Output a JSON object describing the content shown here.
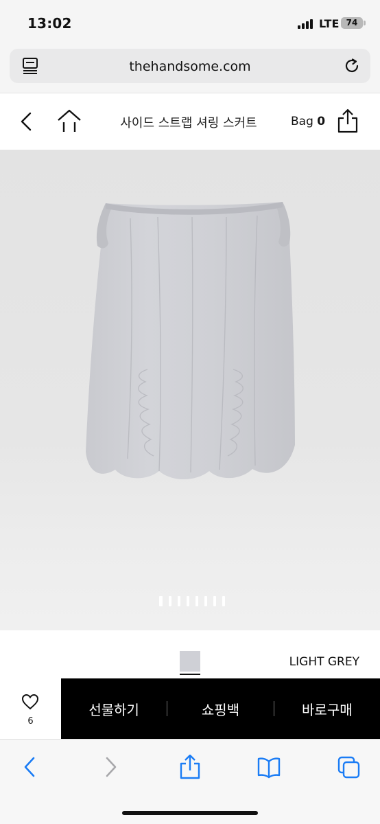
{
  "status_bar": {
    "time": "13:02",
    "carrier": "LTE",
    "battery": "74"
  },
  "browser": {
    "url": "thehandsome.com"
  },
  "header": {
    "title": "사이드 스트랩 셔링 스커트",
    "bag_label": "Bag",
    "bag_count": "0"
  },
  "gallery": {
    "image_count": 8,
    "active_index": 0
  },
  "product": {
    "color_name": "LIGHT GREY",
    "swatch_color": "#cfd0d6"
  },
  "actions": {
    "wish_count": "6",
    "gift": "선물하기",
    "bag": "쇼핑백",
    "buy": "바로구매"
  },
  "toolbar_icons": [
    "back-icon",
    "forward-icon",
    "share-icon",
    "bookmarks-icon",
    "tabs-icon"
  ],
  "colors": {
    "accent_blue": "#1a7cf5",
    "action_bar": "#000000"
  }
}
